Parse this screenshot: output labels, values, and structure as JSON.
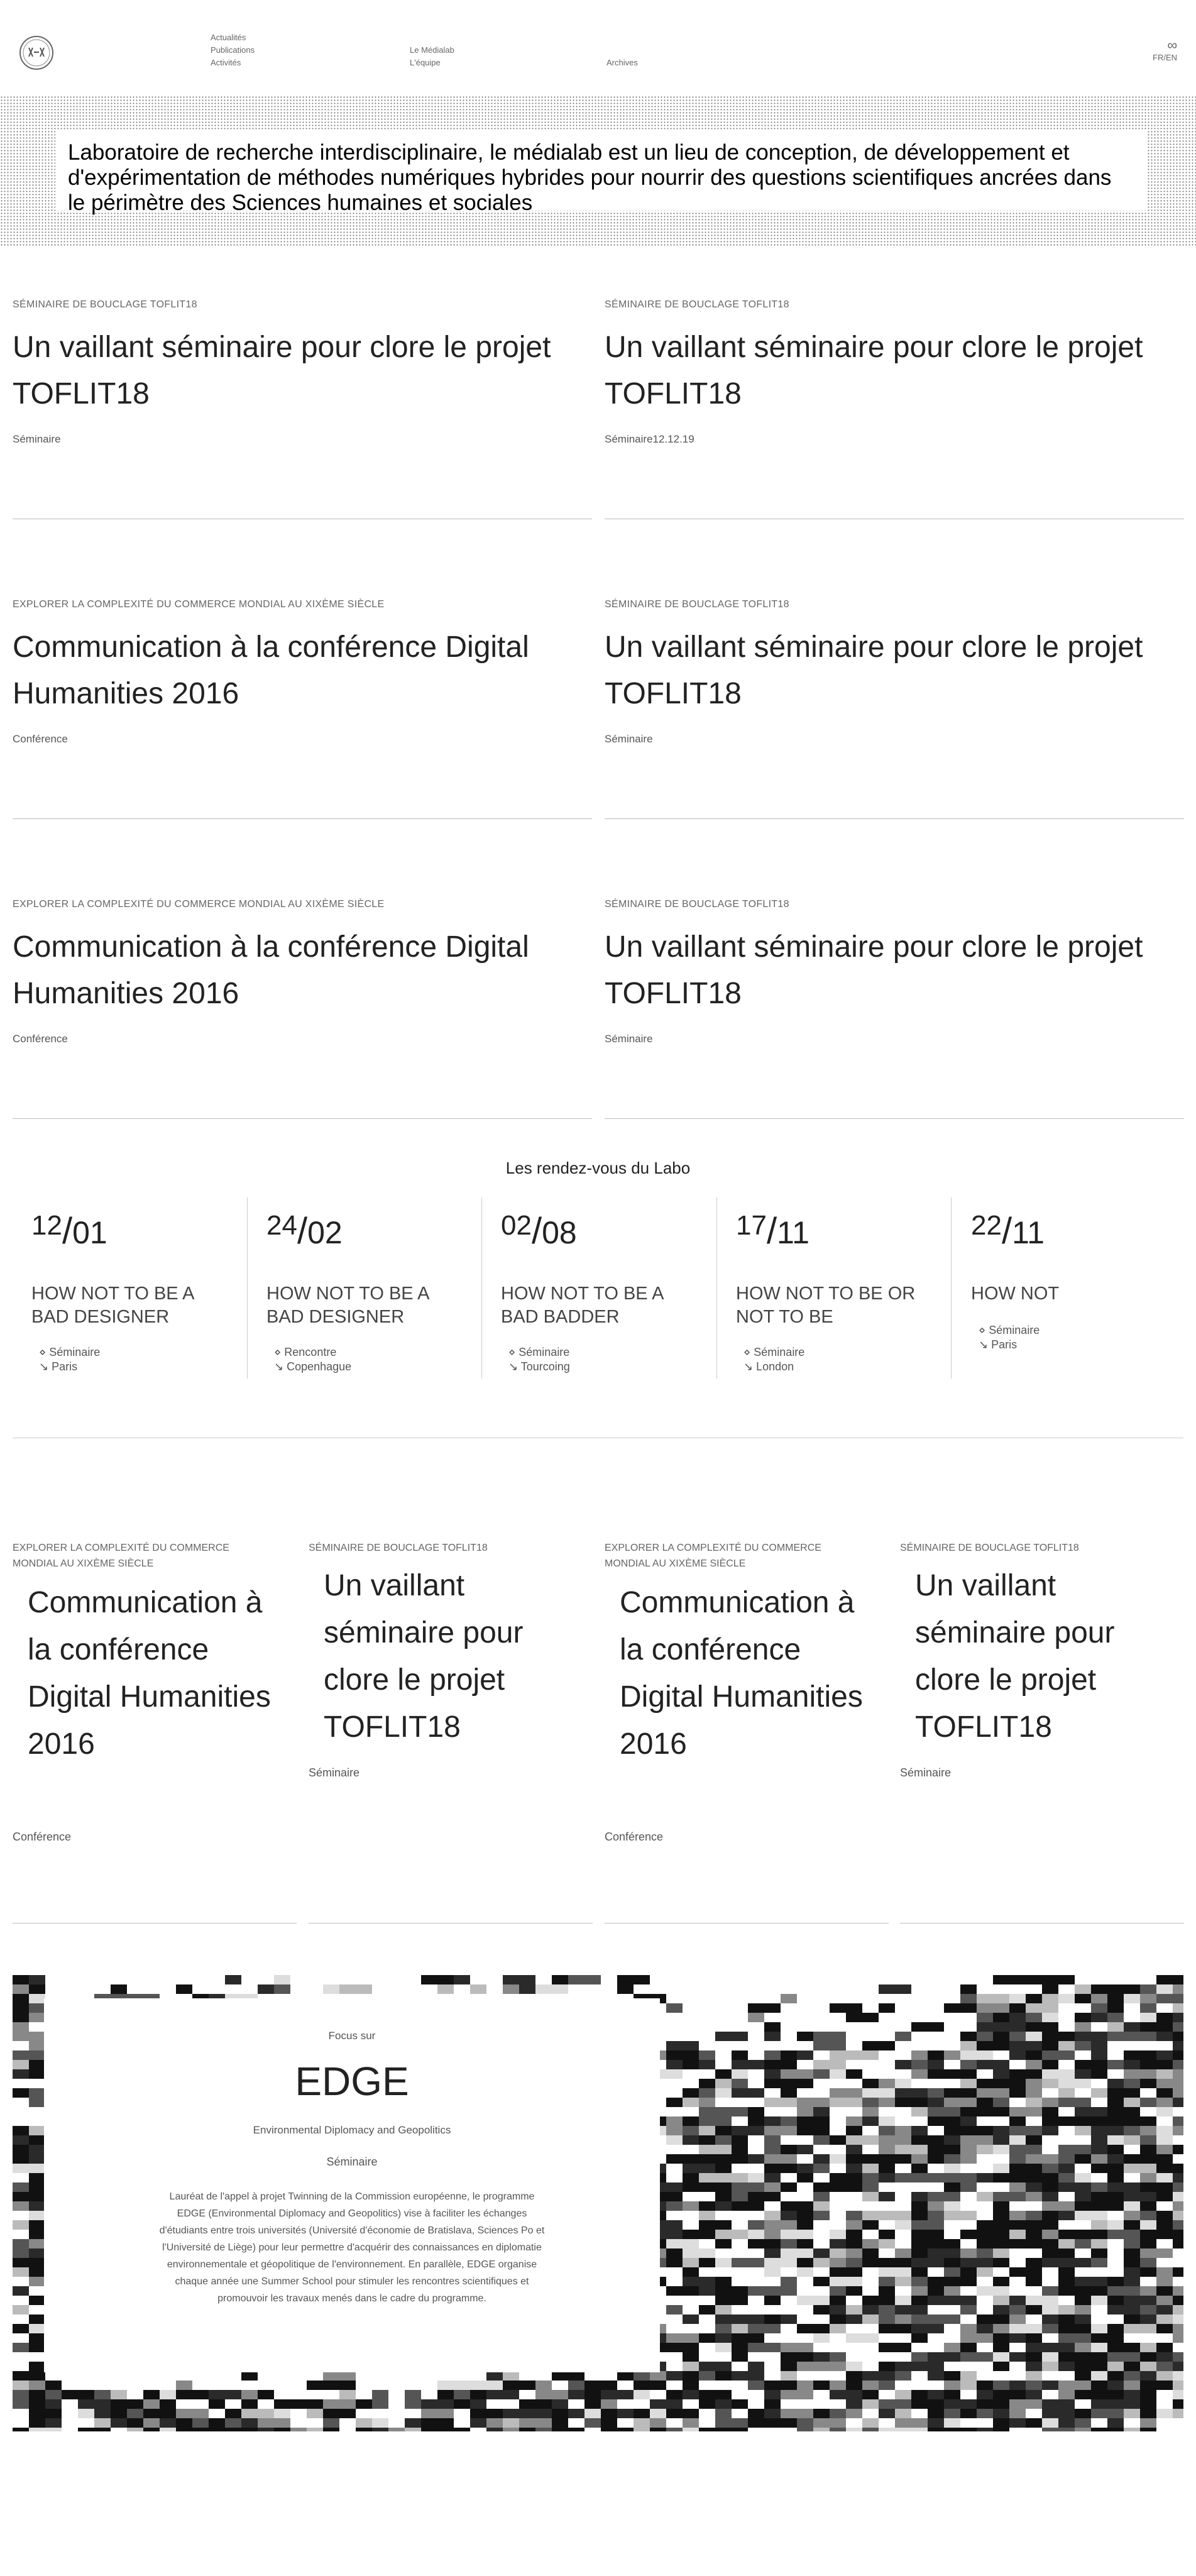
{
  "nav": {
    "col1": [
      "Actualités",
      "Publications",
      "Activités"
    ],
    "col2": [
      "Le Médialab",
      "L'équipe"
    ],
    "col3": [
      "Archives"
    ],
    "lang_symbol": "∞",
    "lang": "FR/EN"
  },
  "hero": {
    "text": "Laboratoire de recherche interdisciplinaire, le médialab est un lieu de conception, de développement et d'expérimentation de méthodes numériques hybrides pour nourrir des questions scientifiques ancrées dans le périmètre des Sciences humaines et sociales"
  },
  "articles": [
    {
      "kicker": "Séminaire de bouclage TOFLIT18",
      "title": "Un vaillant séminaire pour clore le projet TOFLIT18",
      "type": "Séminaire",
      "date": ""
    },
    {
      "kicker": "Séminaire de bouclage TOFLIT18",
      "title": "Un vaillant séminaire pour clore le projet TOFLIT18",
      "type": "Séminaire",
      "date": "12.12.19"
    },
    {
      "kicker": "Explorer la complexité du commerce mondial au XIXème siècle",
      "title": "Communication à la conférence Digital Humanities 2016",
      "type": "Conférence",
      "date": ""
    },
    {
      "kicker": "Séminaire de bouclage TOFLIT18",
      "title": "Un vaillant séminaire pour clore le projet TOFLIT18",
      "type": "Séminaire",
      "date": ""
    },
    {
      "kicker": "Explorer la complexité du commerce mondial au XIXème siècle",
      "title": "Communication à la conférence Digital Humanities 2016",
      "type": "Conférence",
      "date": ""
    },
    {
      "kicker": "Séminaire de bouclage TOFLIT18",
      "title": "Un vaillant séminaire pour clore le projet TOFLIT18",
      "type": "Séminaire",
      "date": ""
    }
  ],
  "rendezvous": {
    "title": "Les rendez-vous du Labo",
    "items": [
      {
        "day": "12",
        "month": "01",
        "name": "How not to be a bad designer",
        "type": "Séminaire",
        "place": "Paris"
      },
      {
        "day": "24",
        "month": "02",
        "name": "How not to be a bad designer",
        "type": "Rencontre",
        "place": "Copenhague"
      },
      {
        "day": "02",
        "month": "08",
        "name": "How not to be a bad badder",
        "type": "Séminaire",
        "place": "Tourcoing"
      },
      {
        "day": "17",
        "month": "11",
        "name": "How not to be or not to be",
        "type": "Séminaire",
        "place": "London"
      },
      {
        "day": "22",
        "month": "11",
        "name": "How not",
        "type": "Séminaire",
        "place": "Paris"
      }
    ]
  },
  "grid": [
    {
      "kicker": "Explorer la complexité du commerce mondial au XIXème siècle",
      "title": "Communication à la conférence Digital Humanities 2016",
      "type": "Conférence"
    },
    {
      "kicker": "Séminaire de bouclage TOFLIT18",
      "title": "Un vaillant séminaire pour clore le projet TOFLIT18",
      "type": "Séminaire"
    },
    {
      "kicker": "Explorer la complexité du commerce mondial au XIXème siècle",
      "title": "Communication à la conférence Digital Humanities 2016",
      "type": "Conférence"
    },
    {
      "kicker": "Séminaire de bouclage TOFLIT18",
      "title": "Un vaillant séminaire pour clore le projet TOFLIT18",
      "type": "Séminaire"
    }
  ],
  "focus": {
    "kicker": "Focus sur",
    "title": "EDGE",
    "subtitle": "Environmental Diplomacy and Geopolitics",
    "tag": "Séminaire",
    "description": "Lauréat de l'appel à projet Twinning de la Commission européenne, le programme EDGE (Environmental Diplomacy and Geopolitics) vise à faciliter les échanges d'étudiants entre trois universités (Université d'économie de Bratislava, Sciences Po et l'Université de Liège) pour leur permettre d'acquérir des connaissances en diplomatie environnementale et géopolitique de l'environnement. En parallèle, EDGE organise chaque année une Summer School pour stimuler les rencontres scientifiques et promouvoir les travaux menés dans le cadre du programme."
  }
}
